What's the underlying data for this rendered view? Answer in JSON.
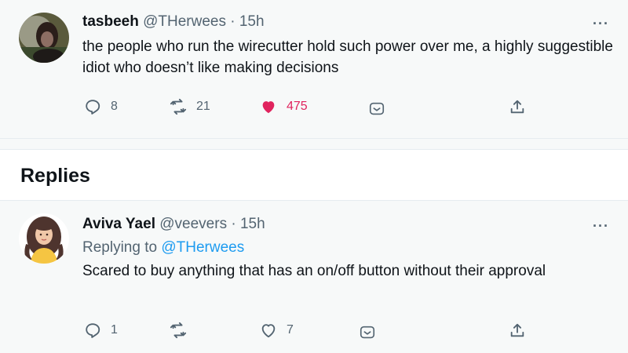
{
  "main_tweet": {
    "name": "tasbeeh",
    "handle": "@THerwees",
    "time": "15h",
    "text": "the people who run the wirecutter hold such power over me, a highly suggestible idiot who doesn’t like making decisions",
    "more": "···",
    "actions": {
      "replies": "8",
      "retweets": "21",
      "likes": "475"
    }
  },
  "section": {
    "title": "Replies"
  },
  "reply_tweet": {
    "name": "Aviva Yael",
    "handle": "@veevers",
    "time": "15h",
    "replying_prefix": "Replying to",
    "replying_handle": "@THerwees",
    "text": "Scared to buy anything that has an on/off button without their approval",
    "more": "···",
    "actions": {
      "replies": "1",
      "likes": "7"
    }
  },
  "colors": {
    "like_active": "#e0245e",
    "mention": "#1d9bf0",
    "muted": "#536471",
    "background": "#f7f9f9"
  },
  "icons": [
    "reply-icon",
    "retweet-icon",
    "like-icon",
    "bookmark-icon",
    "share-icon",
    "more-icon"
  ]
}
